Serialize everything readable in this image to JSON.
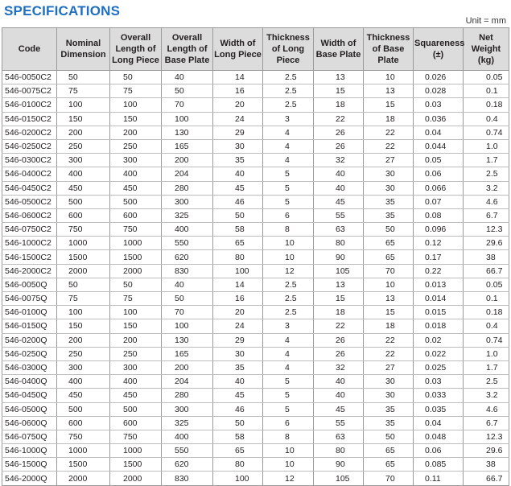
{
  "title": "SPECIFICATIONS",
  "unit_label": "Unit = mm",
  "headers": [
    "Code",
    "Nominal Dimension",
    "Overall Length of Long Piece",
    "Overall Length of Base Plate",
    "Width of Long Piece",
    "Thickness of Long Piece",
    "Width of Base Plate",
    "Thickness of Base Plate",
    "Squareness (±)",
    "Net Weight (kg)"
  ],
  "rows": [
    [
      "546-0050C2",
      "50",
      "50",
      "40",
      "14",
      "2.5",
      "13",
      "10",
      "0.026",
      "0.05"
    ],
    [
      "546-0075C2",
      "75",
      "75",
      "50",
      "16",
      "2.5",
      "15",
      "13",
      "0.028",
      "0.1"
    ],
    [
      "546-0100C2",
      "100",
      "100",
      "70",
      "20",
      "2.5",
      "18",
      "15",
      "0.03",
      "0.18"
    ],
    [
      "546-0150C2",
      "150",
      "150",
      "100",
      "24",
      "3",
      "22",
      "18",
      "0.036",
      "0.4"
    ],
    [
      "546-0200C2",
      "200",
      "200",
      "130",
      "29",
      "4",
      "26",
      "22",
      "0.04",
      "0.74"
    ],
    [
      "546-0250C2",
      "250",
      "250",
      "165",
      "30",
      "4",
      "26",
      "22",
      "0.044",
      "1.0"
    ],
    [
      "546-0300C2",
      "300",
      "300",
      "200",
      "35",
      "4",
      "32",
      "27",
      "0.05",
      "1.7"
    ],
    [
      "546-0400C2",
      "400",
      "400",
      "204",
      "40",
      "5",
      "40",
      "30",
      "0.06",
      "2.5"
    ],
    [
      "546-0450C2",
      "450",
      "450",
      "280",
      "45",
      "5",
      "40",
      "30",
      "0.066",
      "3.2"
    ],
    [
      "546-0500C2",
      "500",
      "500",
      "300",
      "46",
      "5",
      "45",
      "35",
      "0.07",
      "4.6"
    ],
    [
      "546-0600C2",
      "600",
      "600",
      "325",
      "50",
      "6",
      "55",
      "35",
      "0.08",
      "6.7"
    ],
    [
      "546-0750C2",
      "750",
      "750",
      "400",
      "58",
      "8",
      "63",
      "50",
      "0.096",
      "12.3"
    ],
    [
      "546-1000C2",
      "1000",
      "1000",
      "550",
      "65",
      "10",
      "80",
      "65",
      "0.12",
      "29.6"
    ],
    [
      "546-1500C2",
      "1500",
      "1500",
      "620",
      "80",
      "10",
      "90",
      "65",
      "0.17",
      "38"
    ],
    [
      "546-2000C2",
      "2000",
      "2000",
      "830",
      "100",
      "12",
      "105",
      "70",
      "0.22",
      "66.7"
    ],
    [
      "546-0050Q",
      "50",
      "50",
      "40",
      "14",
      "2.5",
      "13",
      "10",
      "0.013",
      "0.05"
    ],
    [
      "546-0075Q",
      "75",
      "75",
      "50",
      "16",
      "2.5",
      "15",
      "13",
      "0.014",
      "0.1"
    ],
    [
      "546-0100Q",
      "100",
      "100",
      "70",
      "20",
      "2.5",
      "18",
      "15",
      "0.015",
      "0.18"
    ],
    [
      "546-0150Q",
      "150",
      "150",
      "100",
      "24",
      "3",
      "22",
      "18",
      "0.018",
      "0.4"
    ],
    [
      "546-0200Q",
      "200",
      "200",
      "130",
      "29",
      "4",
      "26",
      "22",
      "0.02",
      "0.74"
    ],
    [
      "546-0250Q",
      "250",
      "250",
      "165",
      "30",
      "4",
      "26",
      "22",
      "0.022",
      "1.0"
    ],
    [
      "546-0300Q",
      "300",
      "300",
      "200",
      "35",
      "4",
      "32",
      "27",
      "0.025",
      "1.7"
    ],
    [
      "546-0400Q",
      "400",
      "400",
      "204",
      "40",
      "5",
      "40",
      "30",
      "0.03",
      "2.5"
    ],
    [
      "546-0450Q",
      "450",
      "450",
      "280",
      "45",
      "5",
      "40",
      "30",
      "0.033",
      "3.2"
    ],
    [
      "546-0500Q",
      "500",
      "500",
      "300",
      "46",
      "5",
      "45",
      "35",
      "0.035",
      "4.6"
    ],
    [
      "546-0600Q",
      "600",
      "600",
      "325",
      "50",
      "6",
      "55",
      "35",
      "0.04",
      "6.7"
    ],
    [
      "546-0750Q",
      "750",
      "750",
      "400",
      "58",
      "8",
      "63",
      "50",
      "0.048",
      "12.3"
    ],
    [
      "546-1000Q",
      "1000",
      "1000",
      "550",
      "65",
      "10",
      "80",
      "65",
      "0.06",
      "29.6"
    ],
    [
      "546-1500Q",
      "1500",
      "1500",
      "620",
      "80",
      "10",
      "90",
      "65",
      "0.085",
      "38"
    ],
    [
      "546-2000Q",
      "2000",
      "2000",
      "830",
      "100",
      "12",
      "105",
      "70",
      "0.11",
      "66.7"
    ]
  ]
}
